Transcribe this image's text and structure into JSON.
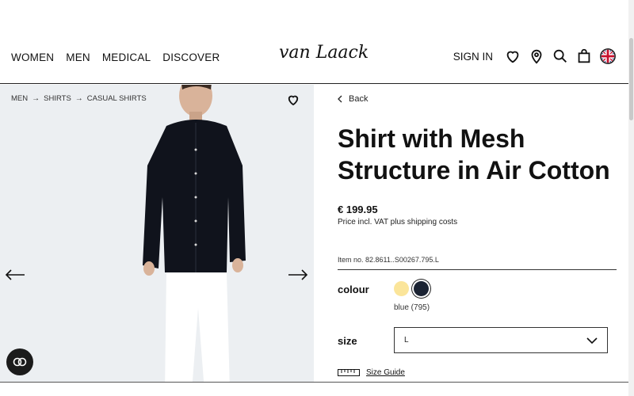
{
  "header": {
    "nav": [
      "WOMEN",
      "MEN",
      "MEDICAL",
      "DISCOVER"
    ],
    "logo": "van Laack",
    "sign_in": "SIGN IN",
    "icons": [
      "heart-icon",
      "location-pin-icon",
      "search-icon",
      "shopping-bag-icon",
      "uk-flag-icon"
    ]
  },
  "gallery": {
    "breadcrumb": [
      "MEN",
      "SHIRTS",
      "CASUAL SHIRTS"
    ]
  },
  "product": {
    "back_label": "Back",
    "title": "Shirt with Mesh Structure in Air Cotton",
    "price": "€ 199.95",
    "price_note": "Price incl. VAT plus shipping costs",
    "item_no": "Item no. 82.8611..S00267.795.L",
    "colour_label": "colour",
    "colour_value": "blue (795)",
    "size_label": "size",
    "size_value": "L",
    "size_guide": "Size Guide"
  },
  "colors": {
    "swatch_yellow": "#fbe59a",
    "swatch_navy": "#1b2333",
    "text": "#111111",
    "gallery_bg": "#eceff2"
  }
}
